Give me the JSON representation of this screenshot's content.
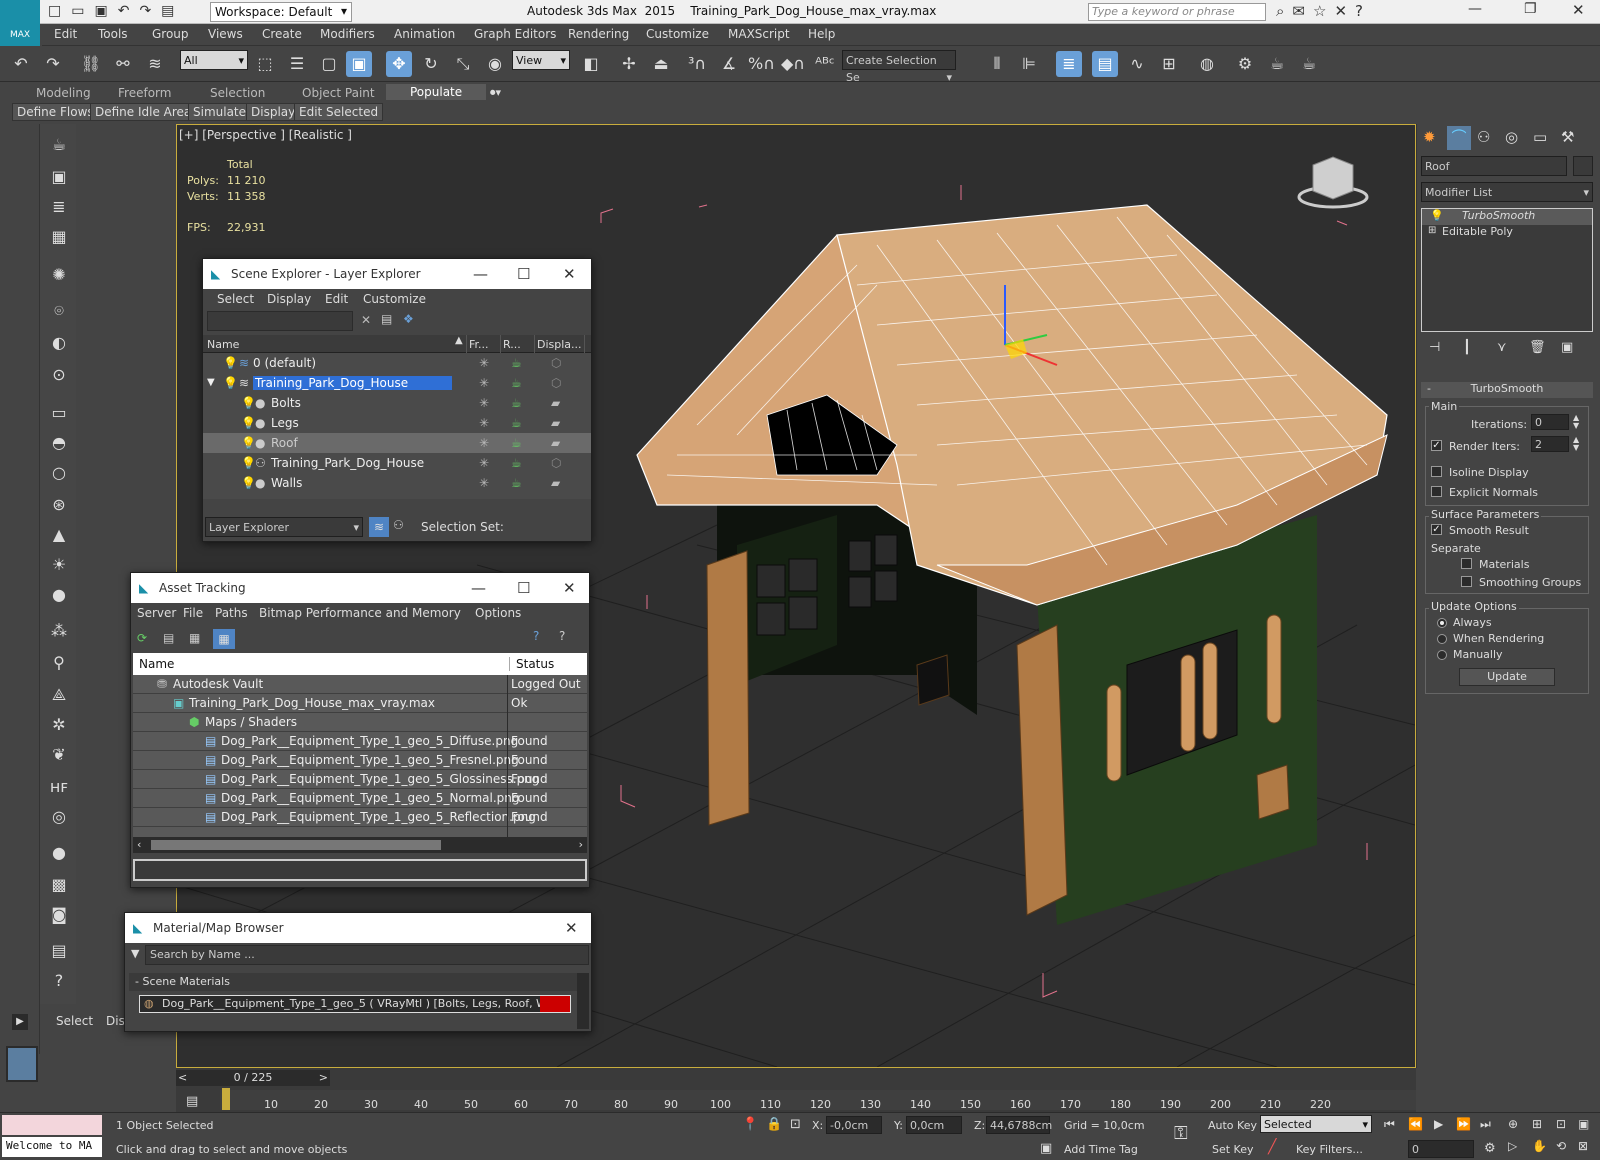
{
  "app": {
    "logo_text": "MAX",
    "workspace": "Workspace: Default",
    "title": "Autodesk 3ds Max  2015    Training_Park_Dog_House_max_vray.max",
    "search_placeholder": "Type a keyword or phrase"
  },
  "menu": [
    "Edit",
    "Tools",
    "Group",
    "Views",
    "Create",
    "Modifiers",
    "Animation",
    "Graph Editors",
    "Rendering",
    "Customize",
    "MAXScript",
    "Help"
  ],
  "toolbar": {
    "selection_filter": "All",
    "reference_coord": "View",
    "selection_set_placeholder": "Create Selection Se"
  },
  "ribbon": {
    "tabs": [
      "Modeling",
      "Freeform",
      "Selection",
      "Object Paint",
      "Populate"
    ],
    "active_tab": "Populate",
    "buttons": [
      "Define Flows",
      "Define Idle Areas",
      "Simulate",
      "Display",
      "Edit Selected"
    ]
  },
  "viewport": {
    "label": "[+] [Perspective ] [Realistic ]",
    "stats": {
      "total_label": "Total",
      "polys_label": "Polys:",
      "polys_value": "11 210",
      "verts_label": "Verts:",
      "verts_value": "11 358",
      "fps_label": "FPS:",
      "fps_value": "22,931"
    }
  },
  "scene_explorer": {
    "title": "Scene Explorer - Layer Explorer",
    "menu": [
      "Select",
      "Display",
      "Edit",
      "Customize"
    ],
    "columns": [
      "Name",
      "Fr...",
      "R...",
      "Displa..."
    ],
    "rows": [
      "0 (default)",
      "Training_Park_Dog_House",
      "Bolts",
      "Legs",
      "Roof",
      "Training_Park_Dog_House",
      "Walls"
    ],
    "footer_dropdown": "Layer Explorer",
    "selection_set_label": "Selection Set:"
  },
  "asset_tracking": {
    "title": "Asset Tracking",
    "menu": [
      "Server",
      "File",
      "Paths",
      "Bitmap Performance and Memory",
      "Options"
    ],
    "columns": [
      "Name",
      "Status"
    ],
    "rows": [
      {
        "name": "Autodesk Vault",
        "status": "Logged Out"
      },
      {
        "name": "Training_Park_Dog_House_max_vray.max",
        "status": "Ok"
      },
      {
        "name": "Maps / Shaders",
        "status": ""
      },
      {
        "name": "Dog_Park__Equipment_Type_1_geo_5_Diffuse.png",
        "status": "Found"
      },
      {
        "name": "Dog_Park__Equipment_Type_1_geo_5_Fresnel.png",
        "status": "Found"
      },
      {
        "name": "Dog_Park__Equipment_Type_1_geo_5_Glossiness.png",
        "status": "Found"
      },
      {
        "name": "Dog_Park__Equipment_Type_1_geo_5_Normal.png",
        "status": "Found"
      },
      {
        "name": "Dog_Park__Equipment_Type_1_geo_5_Reflection.png",
        "status": "Found"
      }
    ]
  },
  "material_browser": {
    "title": "Material/Map Browser",
    "search_placeholder": "Search by Name ...",
    "section": "Scene Materials",
    "material": "Dog_Park__Equipment_Type_1_geo_5 ( VRayMtl ) [Bolts, Legs, Roof, Walls]"
  },
  "command_panel": {
    "object_name": "Roof",
    "modifier_list": "Modifier List",
    "stack": [
      "TurboSmooth",
      "Editable Poly"
    ],
    "rollout_title": "TurboSmooth",
    "main_label": "Main",
    "iterations_label": "Iterations:",
    "iterations_value": "0",
    "render_iters_label": "Render Iters:",
    "render_iters_value": "2",
    "isoline_label": "Isoline Display",
    "explicit_label": "Explicit Normals",
    "surface_label": "Surface Parameters",
    "smooth_label": "Smooth Result",
    "separate_label": "Separate",
    "materials_label": "Materials",
    "smoothing_label": "Smoothing Groups",
    "update_options_label": "Update Options",
    "always_label": "Always",
    "when_rendering_label": "When Rendering",
    "manually_label": "Manually",
    "update_button": "Update"
  },
  "left_lower": {
    "select": "Select",
    "display": "Display"
  },
  "timeline": {
    "frame": "0 / 225",
    "ticks": [
      "10",
      "20",
      "30",
      "40",
      "50",
      "60",
      "70",
      "80",
      "90",
      "100",
      "110",
      "120",
      "130",
      "140",
      "150",
      "160",
      "170",
      "180",
      "190",
      "200",
      "210",
      "220"
    ]
  },
  "status": {
    "welcome": "Welcome to MA",
    "selected": "1 Object Selected",
    "prompt": "Click and drag to select and move objects",
    "x_label": "X:",
    "x_value": "-0,0cm",
    "y_label": "Y:",
    "y_value": "0,0cm",
    "z_label": "Z:",
    "z_value": "44,6788cm",
    "grid": "Grid = 10,0cm",
    "add_time_tag": "Add Time Tag",
    "auto_key": "Auto Key",
    "set_key": "Set Key",
    "selected_dropdown": "Selected",
    "key_filters": "Key Filters...",
    "frame_value": "0"
  }
}
